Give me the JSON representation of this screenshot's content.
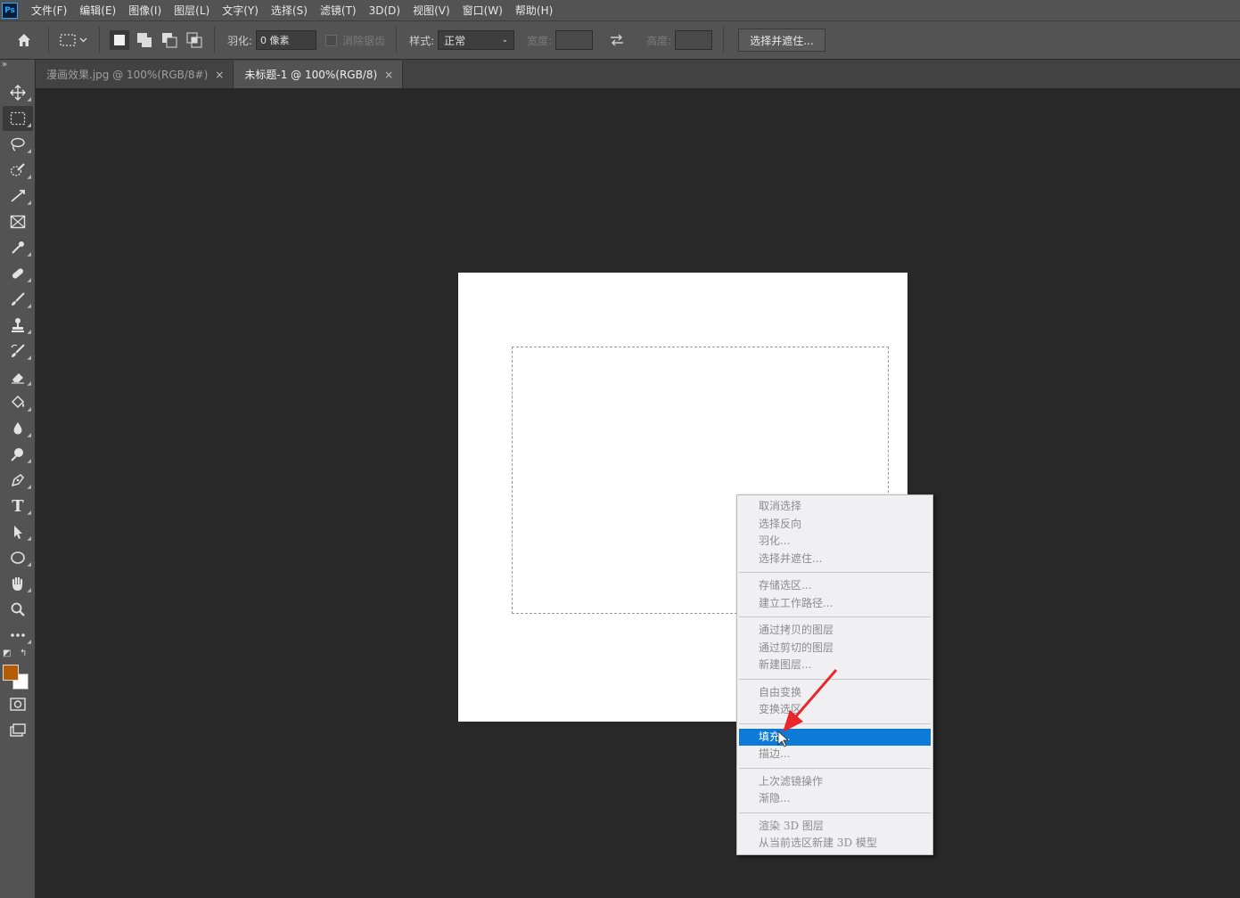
{
  "menubar": {
    "logo": "Ps",
    "items": [
      "文件(F)",
      "编辑(E)",
      "图像(I)",
      "图层(L)",
      "文字(Y)",
      "选择(S)",
      "滤镜(T)",
      "3D(D)",
      "视图(V)",
      "窗口(W)",
      "帮助(H)"
    ]
  },
  "options": {
    "feather_label": "羽化:",
    "feather_value": "0 像素",
    "antialias_label": "消除锯齿",
    "style_label": "样式:",
    "style_value": "正常",
    "width_label": "宽度:",
    "height_label": "高度:",
    "select_mask_label": "选择并遮住..."
  },
  "tabs": [
    {
      "title": "漫画效果.jpg @ 100%(RGB/8#)",
      "close": "×"
    },
    {
      "title": "未标题-1 @ 100%(RGB/8)",
      "close": "×"
    }
  ],
  "toolbar": {
    "collapse": "»",
    "foreground_color": "#b35c06",
    "background_color": "#ffffff"
  },
  "context_menu": {
    "groups": [
      [
        "取消选择",
        "选择反向",
        "羽化...",
        "选择并遮住..."
      ],
      [
        "存储选区...",
        "建立工作路径..."
      ],
      [
        "通过拷贝的图层",
        "通过剪切的图层",
        "新建图层..."
      ],
      [
        "自由变换",
        "变换选区"
      ],
      [
        "填充...",
        "描边..."
      ],
      [
        "上次滤镜操作",
        "渐隐..."
      ],
      [
        "渲染 3D 图层",
        "从当前选区新建 3D 模型"
      ]
    ],
    "highlighted": "填充..."
  },
  "colors": {
    "accent": "#0e7ad8",
    "annotation_arrow": "#e8262b"
  }
}
